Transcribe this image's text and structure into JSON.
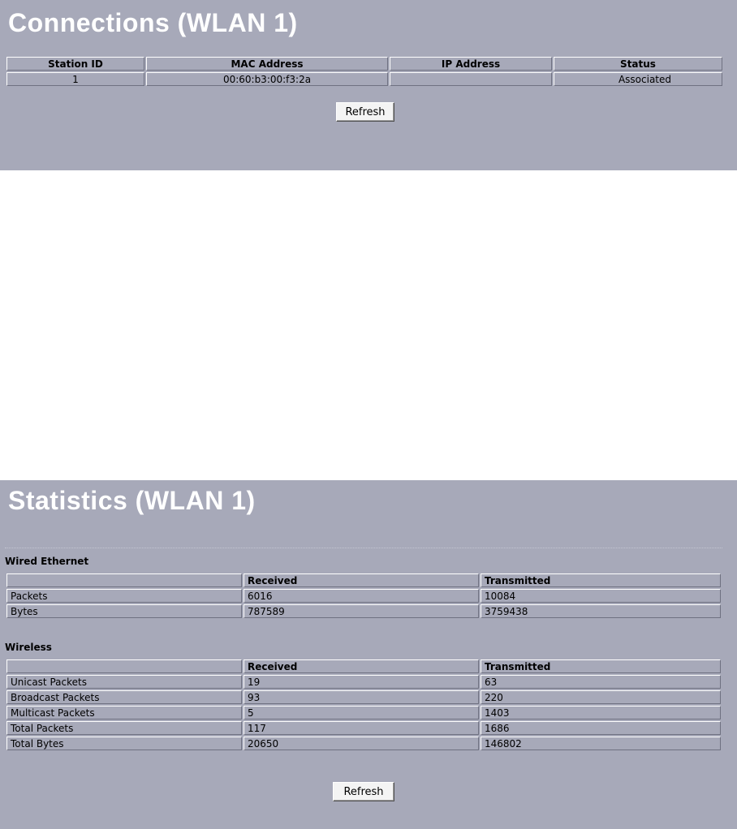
{
  "connections": {
    "title": "Connections (WLAN 1)",
    "headers": [
      "Station ID",
      "MAC Address",
      "IP Address",
      "Status"
    ],
    "rows": [
      {
        "station_id": "1",
        "mac": "00:60:b3:00:f3:2a",
        "ip": "",
        "status": "Associated"
      }
    ],
    "refresh_label": "Refresh"
  },
  "statistics": {
    "title": "Statistics (WLAN 1)",
    "wired": {
      "label": "Wired Ethernet",
      "headers": [
        "",
        "Received",
        "Transmitted"
      ],
      "rows": [
        {
          "name": "Packets",
          "received": "6016",
          "transmitted": "10084"
        },
        {
          "name": "Bytes",
          "received": "787589",
          "transmitted": "3759438"
        }
      ]
    },
    "wireless": {
      "label": "Wireless",
      "headers": [
        "",
        "Received",
        "Transmitted"
      ],
      "rows": [
        {
          "name": "Unicast Packets",
          "received": "19",
          "transmitted": "63"
        },
        {
          "name": "Broadcast Packets",
          "received": "93",
          "transmitted": "220"
        },
        {
          "name": "Multicast Packets",
          "received": "5",
          "transmitted": "1403"
        },
        {
          "name": "Total Packets",
          "received": "117",
          "transmitted": "1686"
        },
        {
          "name": "Total Bytes",
          "received": "20650",
          "transmitted": "146802"
        }
      ]
    },
    "refresh_label": "Refresh"
  },
  "colors": {
    "panel_bg": "#a7a9b9",
    "title_text": "#ffffff"
  }
}
